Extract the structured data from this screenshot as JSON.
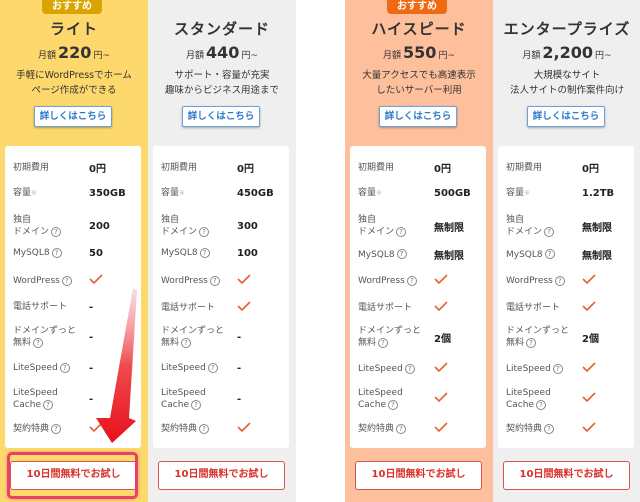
{
  "colors": {
    "lite_bg": "#fdd86c",
    "standard_bg": "#efefef",
    "highspeed_bg": "#fdbf9c",
    "enterprise_bg": "#efefef",
    "lite_badge": "#d9a400",
    "highspeed_badge": "#f06a12",
    "check": "#e8602c",
    "accent_red": "#e8202a"
  },
  "row_labels": [
    {
      "text": "初期費用"
    },
    {
      "text": "容量",
      "star": "※"
    },
    {
      "line1": "独自",
      "line2": "ドメイン",
      "help": "?"
    },
    {
      "text": "MySQL8",
      "help": "?"
    },
    {
      "text": "WordPress",
      "help": "?"
    },
    {
      "text": "電話サポート"
    },
    {
      "line1": "ドメインずっと",
      "line2": "無料",
      "help": "?"
    },
    {
      "text": "LiteSpeed",
      "help": "?"
    },
    {
      "line1": "LiteSpeed",
      "line2": "Cache",
      "help": "?"
    },
    {
      "text": "契約特典",
      "help": "?"
    }
  ],
  "plans": [
    {
      "badge": "おすすめ",
      "name": "ライト",
      "price_prefix": "月額",
      "price": "220",
      "price_suffix": "円~",
      "desc1": "手軽にWordPressでホーム",
      "desc2": "ページ作成ができる",
      "details": "詳しくはこちら",
      "trial": "10日間無料でお試し",
      "values": [
        "0円",
        "350GB",
        "200",
        "50",
        "check",
        "-",
        "-",
        "-",
        "-",
        "check"
      ]
    },
    {
      "name": "スタンダード",
      "price_prefix": "月額",
      "price": "440",
      "price_suffix": "円~",
      "desc1": "サポート・容量が充実",
      "desc2": "趣味からビジネス用途まで",
      "details": "詳しくはこちら",
      "trial": "10日間無料でお試し",
      "values": [
        "0円",
        "450GB",
        "300",
        "100",
        "check",
        "check",
        "-",
        "-",
        "-",
        "check"
      ]
    },
    {
      "badge": "おすすめ",
      "name": "ハイスピード",
      "price_prefix": "月額",
      "price": "550",
      "price_suffix": "円~",
      "desc1": "大量アクセスでも高速表示",
      "desc2": "したいサーバー利用",
      "details": "詳しくはこちら",
      "trial": "10日間無料でお試し",
      "values": [
        "0円",
        "500GB",
        "無制限",
        "無制限",
        "check",
        "check",
        "2個",
        "check",
        "check",
        "check"
      ]
    },
    {
      "name": "エンタープライズ",
      "price_prefix": "月額",
      "price": "2,200",
      "price_suffix": "円~",
      "desc1": "大規模なサイト",
      "desc2": "法人サイトの制作案件向け",
      "details": "詳しくはこちら",
      "trial": "10日間無料でお試し",
      "values": [
        "0円",
        "1.2TB",
        "無制限",
        "無制限",
        "check",
        "check",
        "2個",
        "check",
        "check",
        "check"
      ]
    }
  ]
}
